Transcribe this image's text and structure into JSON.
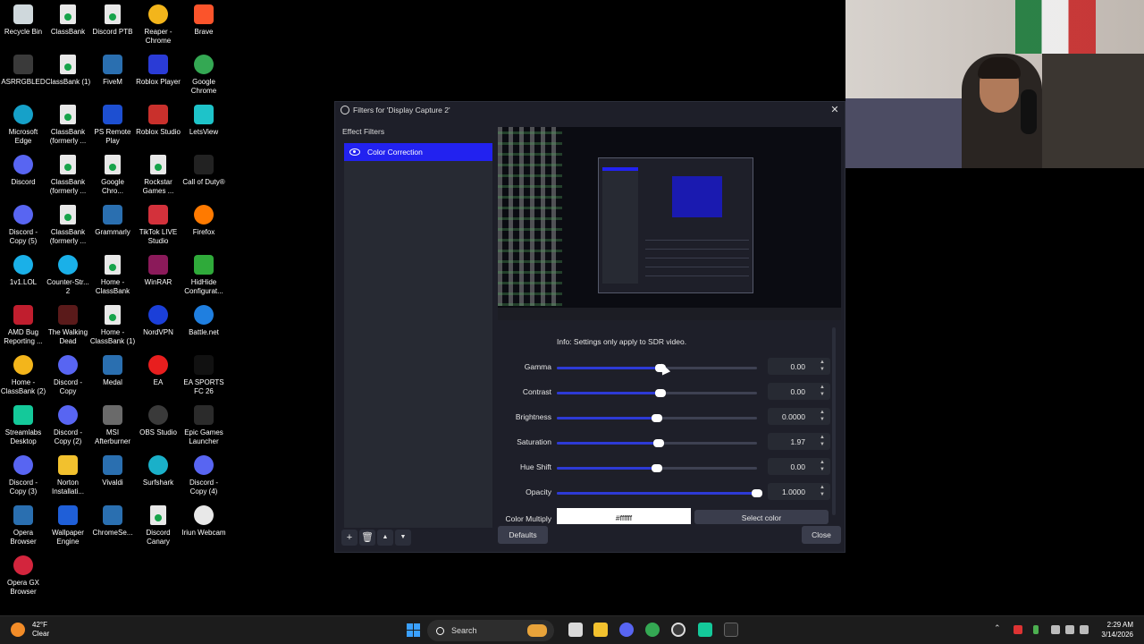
{
  "desktop_icons": [
    {
      "label": "Recycle Bin",
      "icon": "recycle-bin-icon",
      "color": "#cfd8dc"
    },
    {
      "label": "ClassBank",
      "icon": "file-icon",
      "color": "#e8e8e8"
    },
    {
      "label": "Discord PTB",
      "icon": "file-icon",
      "color": "#e8e8e8"
    },
    {
      "label": "Reaper - Chrome",
      "icon": "chrome-icon",
      "color": "#f3b51b"
    },
    {
      "label": "Brave",
      "icon": "brave-icon",
      "color": "#fb542b"
    },
    {
      "label": "ASRRGBLED",
      "icon": "asrock-icon",
      "color": "#3a3a3a"
    },
    {
      "label": "ClassBank (1)",
      "icon": "file-icon",
      "color": "#e8e8e8"
    },
    {
      "label": "FiveM",
      "icon": "window-icon",
      "color": "#2a6fb0"
    },
    {
      "label": "Roblox Player",
      "icon": "roblox-icon",
      "color": "#2a3bd6"
    },
    {
      "label": "Google Chrome",
      "icon": "chrome-icon",
      "color": "#34a853"
    },
    {
      "label": "Microsoft Edge",
      "icon": "edge-icon",
      "color": "#16a1c9"
    },
    {
      "label": "ClassBank (formerly ...",
      "icon": "file-icon",
      "color": "#e8e8e8"
    },
    {
      "label": "PS Remote Play",
      "icon": "playstation-icon",
      "color": "#1d4fd1"
    },
    {
      "label": "Roblox Studio",
      "icon": "roblox-studio-icon",
      "color": "#c9302c"
    },
    {
      "label": "LetsView",
      "icon": "letsview-icon",
      "color": "#1ec3c9"
    },
    {
      "label": "Discord",
      "icon": "discord-icon",
      "color": "#5865f2"
    },
    {
      "label": "ClassBank (formerly ...",
      "icon": "file-icon",
      "color": "#e8e8e8"
    },
    {
      "label": "Google Chro...",
      "icon": "file-icon",
      "color": "#e8e8e8"
    },
    {
      "label": "Rockstar Games ...",
      "icon": "file-icon",
      "color": "#e8e8e8"
    },
    {
      "label": "Call of Duty®",
      "icon": "call-of-duty-icon",
      "color": "#222222"
    },
    {
      "label": "Discord - Copy (5)",
      "icon": "discord-icon",
      "color": "#5865f2"
    },
    {
      "label": "ClassBank (formerly ...",
      "icon": "file-icon",
      "color": "#e8e8e8"
    },
    {
      "label": "Grammarly",
      "icon": "window-icon",
      "color": "#2a6fb0"
    },
    {
      "label": "TikTok LIVE Studio",
      "icon": "tiktok-icon",
      "color": "#d3313b"
    },
    {
      "label": "Firefox",
      "icon": "firefox-icon",
      "color": "#ff7a00"
    },
    {
      "label": "1v1.LOL",
      "icon": "globe-icon",
      "color": "#1ab0e8"
    },
    {
      "label": "Counter-Str... 2",
      "icon": "globe-icon",
      "color": "#1ab0e8"
    },
    {
      "label": "Home - ClassBank",
      "icon": "file-icon",
      "color": "#e8e8e8"
    },
    {
      "label": "WinRAR",
      "icon": "winrar-icon",
      "color": "#8b1a5a"
    },
    {
      "label": "HidHide Configurat...",
      "icon": "hidhide-icon",
      "color": "#2faa3a"
    },
    {
      "label": "AMD Bug Reporting ...",
      "icon": "amd-icon",
      "color": "#c01e2e"
    },
    {
      "label": "The Walking Dead",
      "icon": "walking-dead-icon",
      "color": "#5a1a1a"
    },
    {
      "label": "Home - ClassBank (1)",
      "icon": "file-icon",
      "color": "#e8e8e8"
    },
    {
      "label": "NordVPN",
      "icon": "nordvpn-icon",
      "color": "#1b3fd8"
    },
    {
      "label": "Battle.net",
      "icon": "battlenet-icon",
      "color": "#1f7fe0"
    },
    {
      "label": "Home - ClassBank (2)",
      "icon": "chrome-icon",
      "color": "#f3b51b"
    },
    {
      "label": "Discord - Copy",
      "icon": "discord-icon",
      "color": "#5865f2"
    },
    {
      "label": "Medal",
      "icon": "window-icon",
      "color": "#2a6fb0"
    },
    {
      "label": "EA",
      "icon": "ea-icon",
      "color": "#e81e1e"
    },
    {
      "label": "EA SPORTS FC 26",
      "icon": "ea-sports-icon",
      "color": "#111111"
    },
    {
      "label": "Streamlabs Desktop",
      "icon": "streamlabs-icon",
      "color": "#14c99a"
    },
    {
      "label": "Discord - Copy (2)",
      "icon": "discord-icon",
      "color": "#5865f2"
    },
    {
      "label": "MSI Afterburner",
      "icon": "msi-icon",
      "color": "#6a6a6a"
    },
    {
      "label": "OBS Studio",
      "icon": "obs-icon",
      "color": "#3a3a3a"
    },
    {
      "label": "Epic Games Launcher",
      "icon": "epic-games-icon",
      "color": "#2b2b2b"
    },
    {
      "label": "Discord - Copy (3)",
      "icon": "discord-icon",
      "color": "#5865f2"
    },
    {
      "label": "Norton Installati...",
      "icon": "folder-icon",
      "color": "#f2c12e"
    },
    {
      "label": "Vivaldi",
      "icon": "window-icon",
      "color": "#2a6fb0"
    },
    {
      "label": "Surfshark",
      "icon": "surfshark-icon",
      "color": "#1ab0c9"
    },
    {
      "label": "Discord - Copy (4)",
      "icon": "discord-icon",
      "color": "#5865f2"
    },
    {
      "label": "Opera Browser",
      "icon": "window-icon",
      "color": "#2a6fb0"
    },
    {
      "label": "Wallpaper Engine",
      "icon": "wallpaper-engine-icon",
      "color": "#1f5fd8"
    },
    {
      "label": "ChromeSe...",
      "icon": "window-icon",
      "color": "#2a6fb0"
    },
    {
      "label": "Discord Canary",
      "icon": "file-icon",
      "color": "#e8e8e8"
    },
    {
      "label": "Iriun Webcam",
      "icon": "iriun-icon",
      "color": "#e8e8e8"
    },
    {
      "label": "Opera GX Browser",
      "icon": "opera-gx-icon",
      "color": "#d3253d"
    }
  ],
  "dialog": {
    "title": "Filters for 'Display Capture 2'",
    "effect_filters_header": "Effect Filters",
    "filters": [
      {
        "name": "Color Correction",
        "visible": true,
        "selected": true
      }
    ],
    "info": "Info: Settings only apply to SDR video.",
    "properties": [
      {
        "label": "Gamma",
        "value": "0.00",
        "position": 0.52
      },
      {
        "label": "Contrast",
        "value": "0.00",
        "position": 0.52
      },
      {
        "label": "Brightness",
        "value": "0.0000",
        "position": 0.5
      },
      {
        "label": "Saturation",
        "value": "1.97",
        "position": 0.51
      },
      {
        "label": "Hue Shift",
        "value": "0.00",
        "position": 0.5
      },
      {
        "label": "Opacity",
        "value": "1.0000",
        "position": 1.0
      }
    ],
    "color_multiply": {
      "label": "Color Multiply",
      "value": "#ffffff",
      "button": "Select color"
    },
    "toolbar": {
      "add": "+",
      "remove": "🗑",
      "up": "▲",
      "down": "▼"
    },
    "defaults_button": "Defaults",
    "close_button": "Close",
    "accent": "#2222f0"
  },
  "taskbar": {
    "weather_temp": "42°F",
    "weather_desc": "Clear",
    "search_placeholder": "Search",
    "time": "2:29 AM",
    "date": "3/14/2026"
  }
}
